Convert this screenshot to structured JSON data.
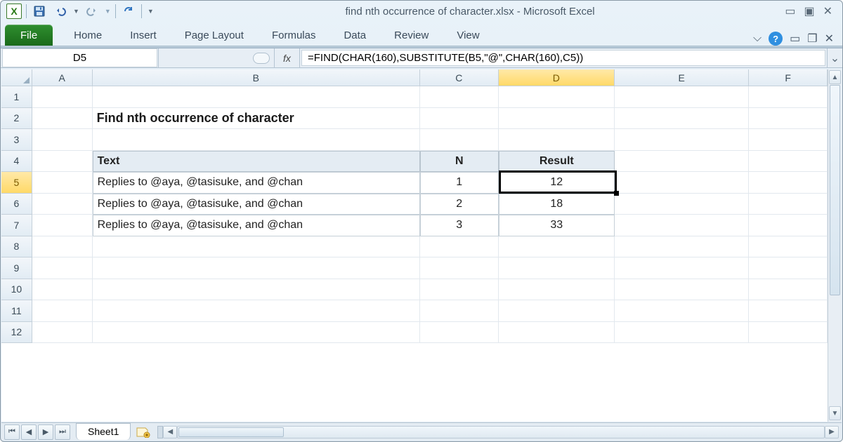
{
  "window": {
    "title": "find nth occurrence of character.xlsx  -  Microsoft Excel"
  },
  "qat": {
    "excel_letter": "X"
  },
  "ribbon": {
    "file": "File",
    "tabs": [
      "Home",
      "Insert",
      "Page Layout",
      "Formulas",
      "Data",
      "Review",
      "View"
    ]
  },
  "namebox": {
    "value": "D5"
  },
  "formula": {
    "fx": "fx",
    "value": "=FIND(CHAR(160),SUBSTITUTE(B5,\"@\",CHAR(160),C5))"
  },
  "columns": [
    "A",
    "B",
    "C",
    "D",
    "E",
    "F"
  ],
  "active_column": "D",
  "row_count": 12,
  "active_row": 5,
  "sheet": {
    "title": "Find nth occurrence of character",
    "headers": {
      "text": "Text",
      "n": "N",
      "result": "Result"
    },
    "rows": [
      {
        "text": "Replies to @aya, @tasisuke, and @chan",
        "n": "1",
        "result": "12"
      },
      {
        "text": "Replies to @aya, @tasisuke, and @chan",
        "n": "2",
        "result": "18"
      },
      {
        "text": "Replies to @aya, @tasisuke, and @chan",
        "n": "3",
        "result": "33"
      }
    ]
  },
  "tabs_bottom": {
    "sheet1": "Sheet1"
  },
  "colors": {
    "accent": "#ffd968",
    "selection": "#000000"
  }
}
